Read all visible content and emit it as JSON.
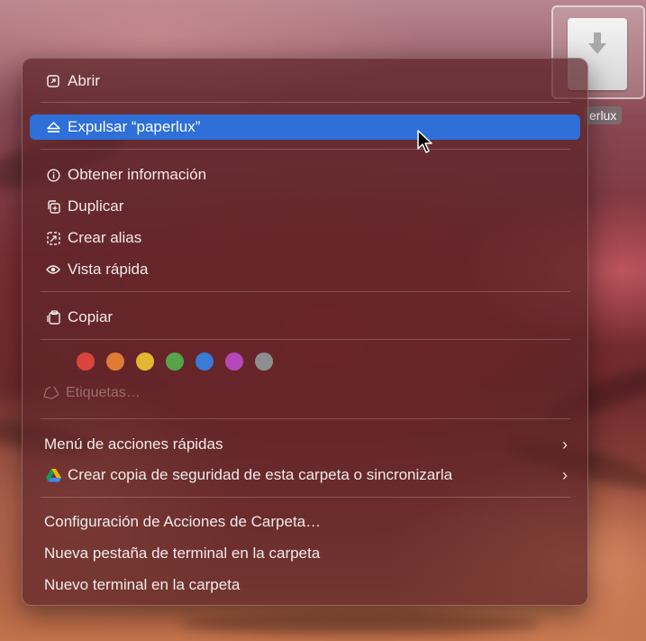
{
  "desktop": {
    "drive_label": "erlux"
  },
  "menu": {
    "open": "Abrir",
    "eject": "Expulsar “paperlux”",
    "get_info": "Obtener información",
    "duplicate": "Duplicar",
    "make_alias": "Crear alias",
    "quick_look": "Vista rápida",
    "copy": "Copiar",
    "tags_label": "Etiquetas…",
    "quick_actions": "Menú de acciones rápidas",
    "google_drive_backup": "Crear copia de seguridad de esta carpeta o sincronizarla",
    "folder_actions_setup": "Configuración de Acciones de Carpeta…",
    "new_terminal_tab": "Nueva pestaña de terminal en la carpeta",
    "new_terminal": "Nuevo terminal en la carpeta"
  },
  "tag_colors": [
    "#d9453e",
    "#e07a34",
    "#e5b631",
    "#55a44a",
    "#3a7ad9",
    "#b548b8",
    "#8e8e8e"
  ],
  "colors": {
    "highlight": "#2e6fd8",
    "menu_background": "#5c2428"
  },
  "icons": {
    "open": "open-window-icon",
    "eject": "eject-icon",
    "get_info": "info-icon",
    "duplicate": "duplicate-icon",
    "make_alias": "alias-icon",
    "quick_look": "eye-icon",
    "copy": "copy-icon",
    "tags": "tag-icon",
    "google_drive": "google-drive-icon",
    "chevron": "chevron-right-icon"
  }
}
